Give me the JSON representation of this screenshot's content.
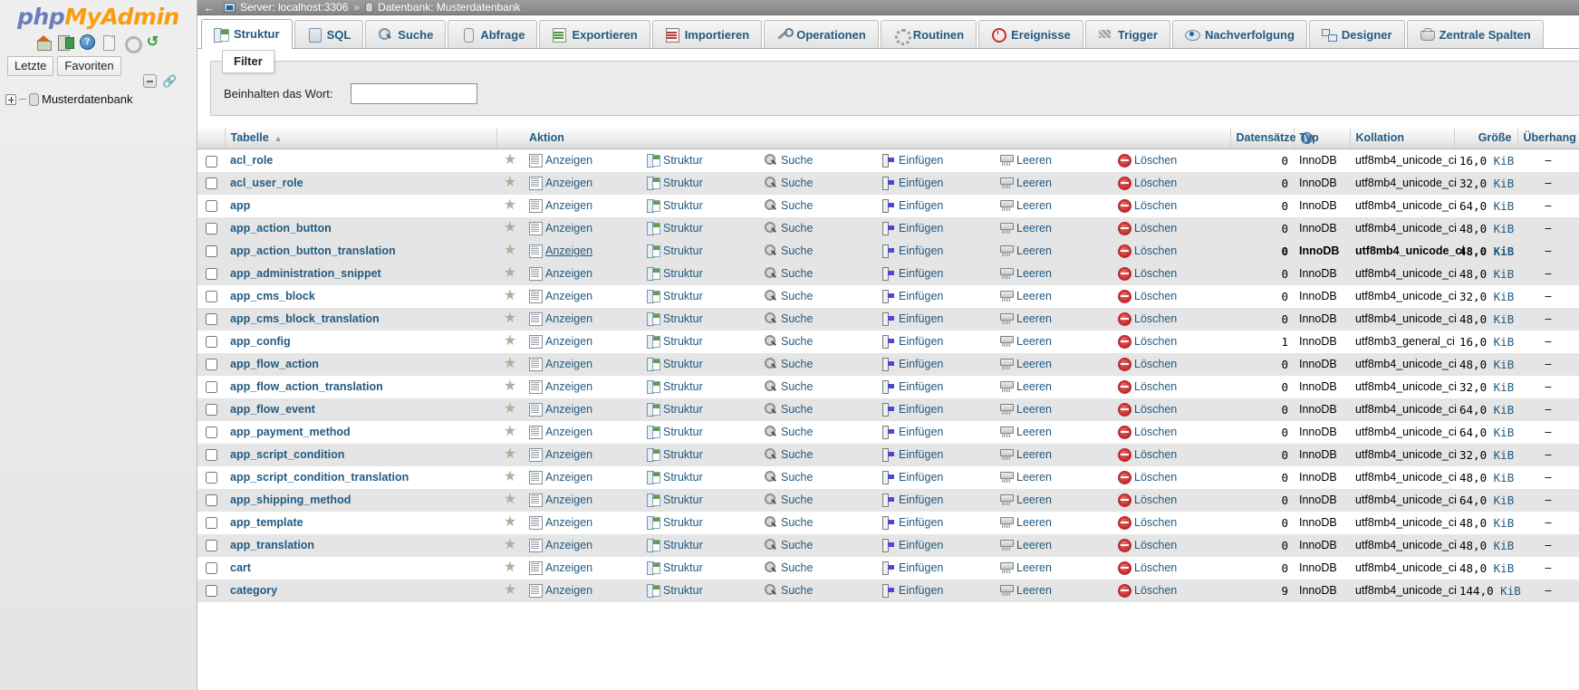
{
  "app": {
    "logo_php": "php",
    "logo_my": "My",
    "logo_admin": "Admin"
  },
  "sidebar": {
    "icons": [
      {
        "name": "home-icon",
        "label": "Startseite"
      },
      {
        "name": "logout-icon",
        "label": "Abmelden"
      },
      {
        "name": "help-icon",
        "label": "?"
      },
      {
        "name": "documentation-icon",
        "label": "Dokumentation"
      },
      {
        "name": "settings-gear-icon",
        "label": "Einstellungen"
      },
      {
        "name": "reload-icon",
        "label": "Neu laden"
      }
    ],
    "tabs": [
      {
        "label": "Letzte"
      },
      {
        "label": "Favoriten"
      }
    ],
    "tree_controls": [
      {
        "name": "collapse-all-icon"
      },
      {
        "name": "link-with-main-panel-icon"
      }
    ],
    "tree": {
      "database": "Musterdatenbank"
    }
  },
  "breadcrumb": {
    "back_arrow": "←",
    "server_label": "Server: localhost:3306",
    "separator": "»",
    "database_label": "Datenbank: Musterdatenbank"
  },
  "tabs": [
    {
      "label": "Struktur",
      "icon": "structure-icon",
      "active": true
    },
    {
      "label": "SQL",
      "icon": "sql-icon",
      "active": false
    },
    {
      "label": "Suche",
      "icon": "search-icon",
      "active": false
    },
    {
      "label": "Abfrage",
      "icon": "query-icon",
      "active": false
    },
    {
      "label": "Exportieren",
      "icon": "export-icon",
      "active": false
    },
    {
      "label": "Importieren",
      "icon": "import-icon",
      "active": false
    },
    {
      "label": "Operationen",
      "icon": "operations-wrench-icon",
      "active": false
    },
    {
      "label": "Routinen",
      "icon": "routines-icon",
      "active": false
    },
    {
      "label": "Ereignisse",
      "icon": "events-clock-icon",
      "active": false
    },
    {
      "label": "Trigger",
      "icon": "trigger-icon",
      "active": false
    },
    {
      "label": "Nachverfolgung",
      "icon": "tracking-eye-icon",
      "active": false
    },
    {
      "label": "Designer",
      "icon": "designer-icon",
      "active": false
    },
    {
      "label": "Zentrale Spalten",
      "icon": "central-columns-icon",
      "active": false
    }
  ],
  "filter": {
    "legend": "Filter",
    "label": "Beinhalten das Wort:",
    "value": "",
    "placeholder": ""
  },
  "table": {
    "headers": {
      "checkbox": "",
      "name": "Tabelle",
      "sort_indicator": "▲",
      "action": "Aktion",
      "records": "Datensätze",
      "records_help": "?",
      "type": "Typ",
      "collation": "Kollation",
      "size": "Größe",
      "overhead": "Überhang"
    },
    "actions": [
      {
        "key": "browse",
        "label": "Anzeigen",
        "icon": "browse-icon"
      },
      {
        "key": "structure",
        "label": "Struktur",
        "icon": "structure-icon"
      },
      {
        "key": "search",
        "label": "Suche",
        "icon": "search-icon"
      },
      {
        "key": "insert",
        "label": "Einfügen",
        "icon": "insert-icon"
      },
      {
        "key": "empty",
        "label": "Leeren",
        "icon": "empty-icon"
      },
      {
        "key": "drop",
        "label": "Löschen",
        "icon": "drop-icon"
      }
    ],
    "favorite_icon": "star-icon",
    "rows": [
      {
        "name": "acl_role",
        "records": "0",
        "type": "InnoDB",
        "collation": "utf8mb4_unicode_ci",
        "size": "16,0",
        "size_unit": "KiB",
        "overhead": "–",
        "hovered": false
      },
      {
        "name": "acl_user_role",
        "records": "0",
        "type": "InnoDB",
        "collation": "utf8mb4_unicode_ci",
        "size": "32,0",
        "size_unit": "KiB",
        "overhead": "–",
        "hovered": false
      },
      {
        "name": "app",
        "records": "0",
        "type": "InnoDB",
        "collation": "utf8mb4_unicode_ci",
        "size": "64,0",
        "size_unit": "KiB",
        "overhead": "–",
        "hovered": false
      },
      {
        "name": "app_action_button",
        "records": "0",
        "type": "InnoDB",
        "collation": "utf8mb4_unicode_ci",
        "size": "48,0",
        "size_unit": "KiB",
        "overhead": "–",
        "hovered": false
      },
      {
        "name": "app_action_button_translation",
        "records": "0",
        "type": "InnoDB",
        "collation": "utf8mb4_unicode_ci",
        "size": "48,0",
        "size_unit": "KiB",
        "overhead": "–",
        "hovered": true
      },
      {
        "name": "app_administration_snippet",
        "records": "0",
        "type": "InnoDB",
        "collation": "utf8mb4_unicode_ci",
        "size": "48,0",
        "size_unit": "KiB",
        "overhead": "–",
        "hovered": false
      },
      {
        "name": "app_cms_block",
        "records": "0",
        "type": "InnoDB",
        "collation": "utf8mb4_unicode_ci",
        "size": "32,0",
        "size_unit": "KiB",
        "overhead": "–",
        "hovered": false
      },
      {
        "name": "app_cms_block_translation",
        "records": "0",
        "type": "InnoDB",
        "collation": "utf8mb4_unicode_ci",
        "size": "48,0",
        "size_unit": "KiB",
        "overhead": "–",
        "hovered": false
      },
      {
        "name": "app_config",
        "records": "1",
        "type": "InnoDB",
        "collation": "utf8mb3_general_ci",
        "size": "16,0",
        "size_unit": "KiB",
        "overhead": "–",
        "hovered": false
      },
      {
        "name": "app_flow_action",
        "records": "0",
        "type": "InnoDB",
        "collation": "utf8mb4_unicode_ci",
        "size": "48,0",
        "size_unit": "KiB",
        "overhead": "–",
        "hovered": false
      },
      {
        "name": "app_flow_action_translation",
        "records": "0",
        "type": "InnoDB",
        "collation": "utf8mb4_unicode_ci",
        "size": "32,0",
        "size_unit": "KiB",
        "overhead": "–",
        "hovered": false
      },
      {
        "name": "app_flow_event",
        "records": "0",
        "type": "InnoDB",
        "collation": "utf8mb4_unicode_ci",
        "size": "64,0",
        "size_unit": "KiB",
        "overhead": "–",
        "hovered": false
      },
      {
        "name": "app_payment_method",
        "records": "0",
        "type": "InnoDB",
        "collation": "utf8mb4_unicode_ci",
        "size": "64,0",
        "size_unit": "KiB",
        "overhead": "–",
        "hovered": false
      },
      {
        "name": "app_script_condition",
        "records": "0",
        "type": "InnoDB",
        "collation": "utf8mb4_unicode_ci",
        "size": "32,0",
        "size_unit": "KiB",
        "overhead": "–",
        "hovered": false
      },
      {
        "name": "app_script_condition_translation",
        "records": "0",
        "type": "InnoDB",
        "collation": "utf8mb4_unicode_ci",
        "size": "48,0",
        "size_unit": "KiB",
        "overhead": "–",
        "hovered": false
      },
      {
        "name": "app_shipping_method",
        "records": "0",
        "type": "InnoDB",
        "collation": "utf8mb4_unicode_ci",
        "size": "64,0",
        "size_unit": "KiB",
        "overhead": "–",
        "hovered": false
      },
      {
        "name": "app_template",
        "records": "0",
        "type": "InnoDB",
        "collation": "utf8mb4_unicode_ci",
        "size": "48,0",
        "size_unit": "KiB",
        "overhead": "–",
        "hovered": false
      },
      {
        "name": "app_translation",
        "records": "0",
        "type": "InnoDB",
        "collation": "utf8mb4_unicode_ci",
        "size": "48,0",
        "size_unit": "KiB",
        "overhead": "–",
        "hovered": false
      },
      {
        "name": "cart",
        "records": "0",
        "type": "InnoDB",
        "collation": "utf8mb4_unicode_ci",
        "size": "48,0",
        "size_unit": "KiB",
        "overhead": "–",
        "hovered": false
      },
      {
        "name": "category",
        "records": "9",
        "type": "InnoDB",
        "collation": "utf8mb4_unicode_ci",
        "size": "144,0",
        "size_unit": "KiB",
        "overhead": "–",
        "hovered": false
      }
    ]
  },
  "colors": {
    "link": "#235a81",
    "brand_blue": "#6c7eb7",
    "brand_orange": "#f89d0e",
    "row_even": "#e5e5e5",
    "breadcrumb_bg": "#8c8c8c"
  }
}
